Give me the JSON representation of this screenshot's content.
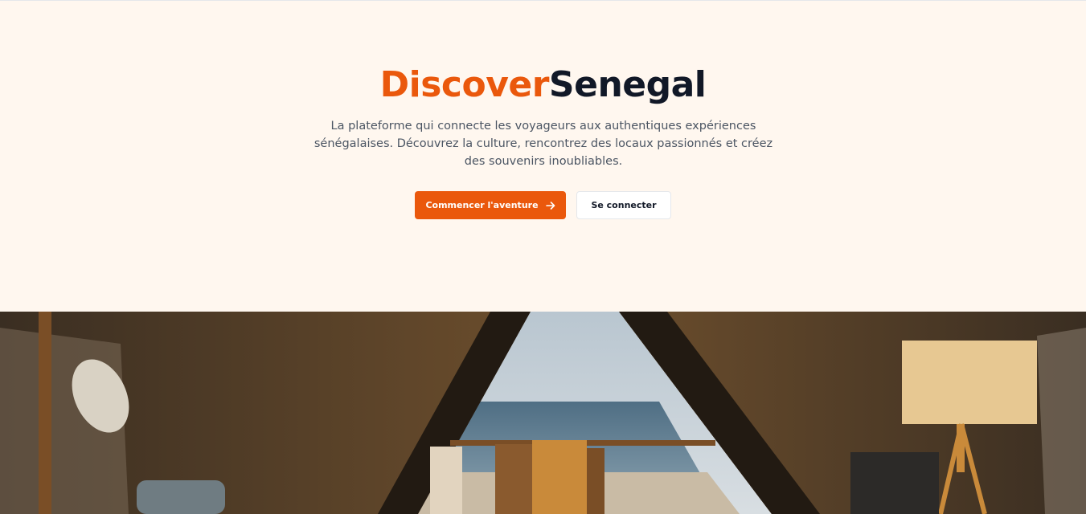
{
  "hero": {
    "title_accent": "Discover",
    "title_main": "Senegal",
    "description": "La plateforme qui connecte les voyageurs aux authentiques expériences sénégalaises. Découvrez la culture, rencontrez des locaux passionnés et créez des souvenirs inoubliables.",
    "primary_button": {
      "label": "Commencer l'aventure",
      "icon": "arrow-right-icon"
    },
    "secondary_button": {
      "label": "Se connecter"
    }
  },
  "colors": {
    "accent": "#ea580c",
    "heading": "#111827",
    "hero_background": "#fff7ef",
    "body_text": "#4b5563"
  }
}
